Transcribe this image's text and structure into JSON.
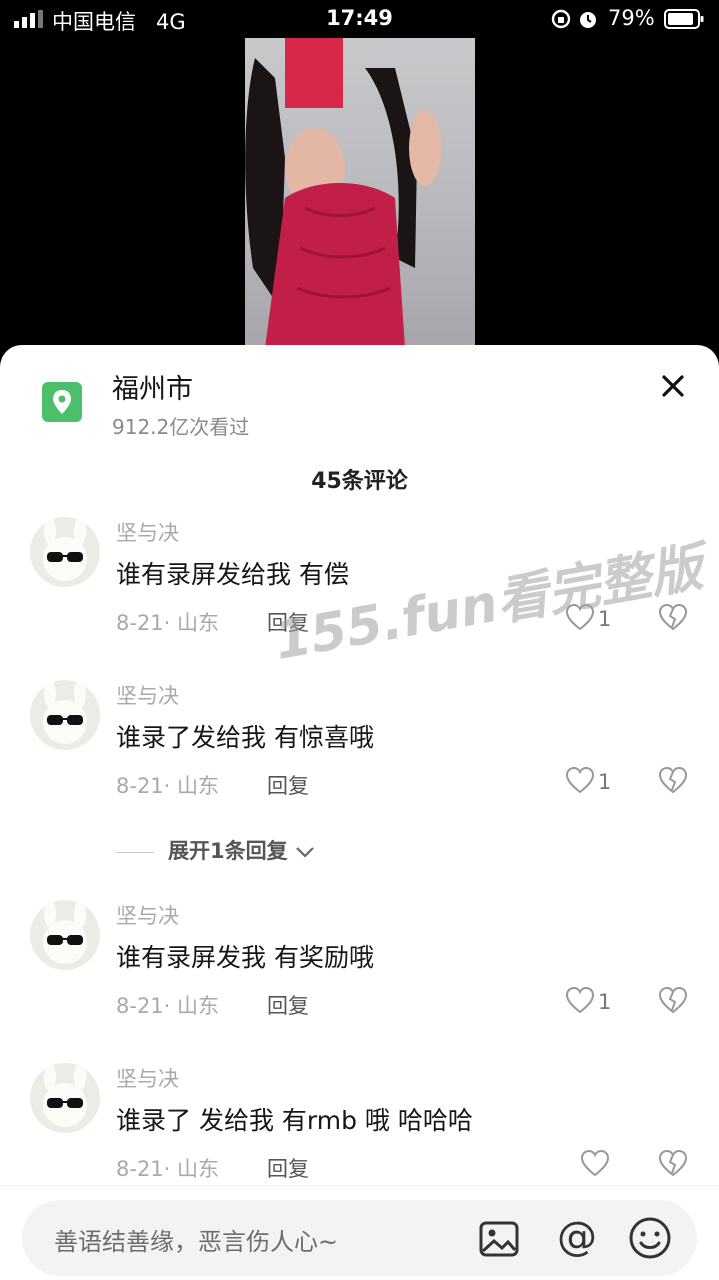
{
  "status_bar": {
    "carrier": "中国电信",
    "network": "4G",
    "time": "17:49",
    "battery": "79%"
  },
  "panel": {
    "location_name": "福州市",
    "views": "912.2亿次看过",
    "comment_count_title": "45条评论",
    "icons": {
      "location": "map-pin-icon",
      "close": "close-icon"
    }
  },
  "comments": [
    {
      "user": "坚与决",
      "text": "谁有录屏发给我 有偿",
      "date_loc": "8-21· 山东",
      "reply": "回复",
      "likes": "1"
    },
    {
      "user": "坚与决",
      "text": "谁录了发给我 有惊喜哦",
      "date_loc": "8-21· 山东",
      "reply": "回复",
      "likes": "1"
    },
    {
      "user": "坚与决",
      "text": "谁有录屏发我 有奖励哦",
      "date_loc": "8-21· 山东",
      "reply": "回复",
      "likes": "1"
    },
    {
      "user": "坚与决",
      "text": "谁录了 发给我 有rmb 哦 哈哈哈",
      "date_loc": "8-21· 山东",
      "reply": "回复",
      "likes": ""
    }
  ],
  "expand_replies": "展开1条回复",
  "input": {
    "placeholder": "善语结善缘，恶言伤人心~",
    "at_symbol": "@",
    "icons": [
      "image-icon",
      "at-icon",
      "emoji-icon"
    ]
  },
  "watermark": "155.fun看完整版",
  "colors": {
    "location_icon": "#4cbf6a",
    "sheet_bg": "#ffffff",
    "muted_text": "#a9a9a9"
  }
}
